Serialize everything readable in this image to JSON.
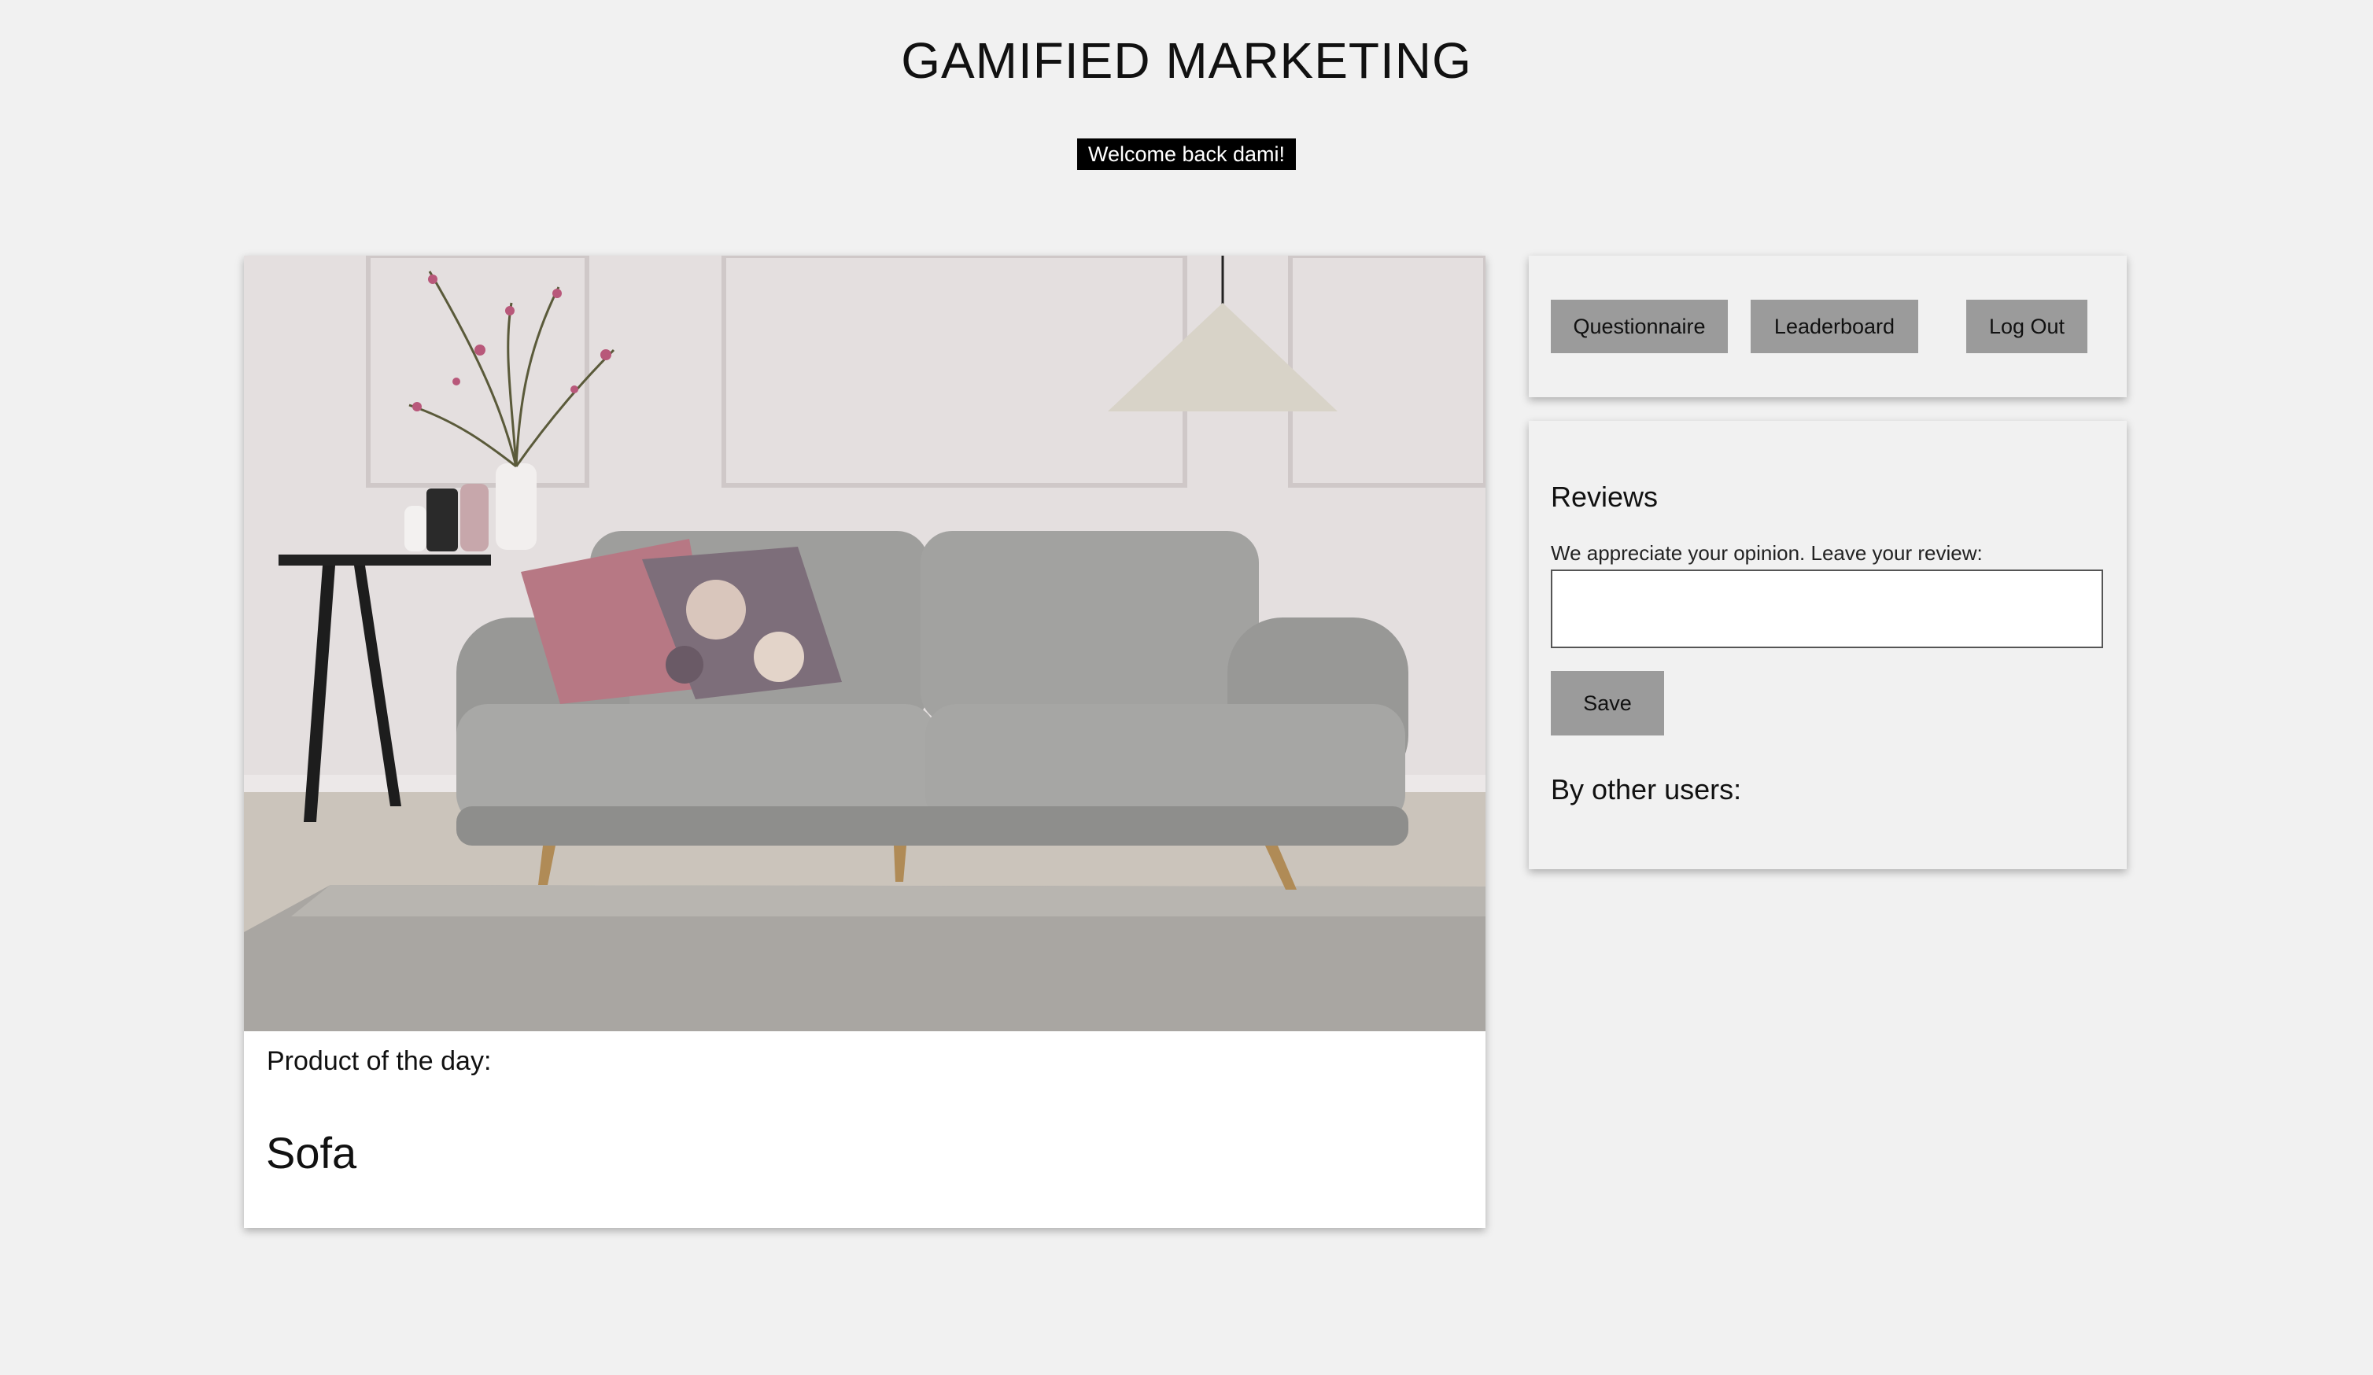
{
  "header": {
    "title": "GAMIFIED MARKETING",
    "welcome": "Welcome back dami!"
  },
  "product": {
    "label": "Product of the day:",
    "name": "Sofa",
    "image": "photo of a grey sofa in a living room"
  },
  "nav": {
    "questionnaire": "Questionnaire",
    "leaderboard": "Leaderboard",
    "logout": "Log Out"
  },
  "reviews": {
    "title": "Reviews",
    "prompt": "We appreciate your opinion. Leave your review:",
    "input_value": "",
    "save": "Save",
    "other_users_title": "By other users:"
  },
  "colors": {
    "page_bg": "#f1f1f1",
    "button_bg": "#9b9b9b",
    "badge_bg": "#000000"
  }
}
